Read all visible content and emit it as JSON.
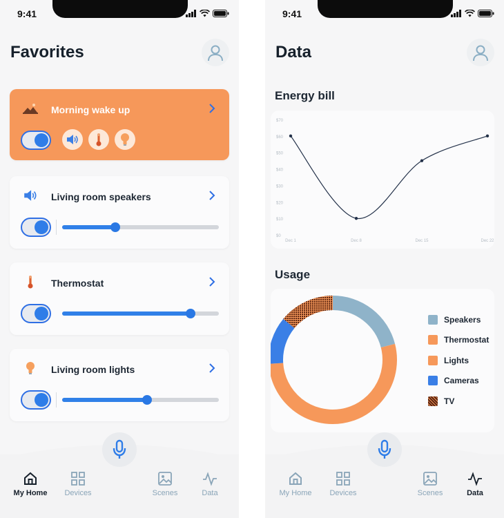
{
  "status": {
    "time": "9:41"
  },
  "favorites": {
    "title": "Favorites",
    "cards": [
      {
        "title": "Morning wake up",
        "icon": "sunrise-icon",
        "enabled": true
      },
      {
        "title": "Living room speakers",
        "icon": "speaker-icon",
        "enabled": true,
        "level": 0.34
      },
      {
        "title": "Thermostat",
        "icon": "thermometer-icon",
        "enabled": true,
        "level": 0.82
      },
      {
        "title": "Living room lights",
        "icon": "lightbulb-icon",
        "enabled": true,
        "level": 0.54
      }
    ],
    "scene_icons": [
      "speaker-icon",
      "thermometer-icon",
      "lightbulb-icon"
    ]
  },
  "data_screen": {
    "title": "Data",
    "energy_title": "Energy bill",
    "usage_title": "Usage"
  },
  "nav_left": {
    "items": [
      {
        "label": "My Home",
        "icon": "home-icon",
        "active": true
      },
      {
        "label": "Devices",
        "icon": "grid-icon",
        "active": false
      },
      {
        "label": "Scenes",
        "icon": "image-icon",
        "active": false
      },
      {
        "label": "Data",
        "icon": "activity-icon",
        "active": false
      }
    ]
  },
  "nav_right": {
    "items": [
      {
        "label": "My Home",
        "icon": "home-icon",
        "active": false
      },
      {
        "label": "Devices",
        "icon": "grid-icon",
        "active": false
      },
      {
        "label": "Scenes",
        "icon": "image-icon",
        "active": false
      },
      {
        "label": "Data",
        "icon": "activity-icon",
        "active": true
      }
    ]
  },
  "colors": {
    "accent": "#3080e8",
    "orange": "#f6985a",
    "speakers": "#8fb3c9",
    "thermostat": "#f6985a",
    "lights": "#f6985a",
    "cameras": "#3a7fe6",
    "tv": "#7a3a1c"
  },
  "chart_data": [
    {
      "type": "line",
      "title": "Energy bill",
      "categories": [
        "Dec 1",
        "Dec 8",
        "Dec 15",
        "Dec 22"
      ],
      "values": [
        60,
        10,
        45,
        60
      ],
      "yticks": [
        "$0",
        "$10",
        "$20",
        "$30",
        "$40",
        "$50",
        "$60",
        "$70"
      ],
      "ylim": [
        0,
        70
      ],
      "grid": false
    },
    {
      "type": "pie",
      "title": "Usage",
      "donut": true,
      "legend_position": "right",
      "slices": [
        {
          "label": "Speakers",
          "value": 21
        },
        {
          "label": "Thermostat",
          "value": 0
        },
        {
          "label": "Lights",
          "value": 53
        },
        {
          "label": "Cameras",
          "value": 12
        },
        {
          "label": "TV",
          "value": 14
        }
      ]
    }
  ]
}
